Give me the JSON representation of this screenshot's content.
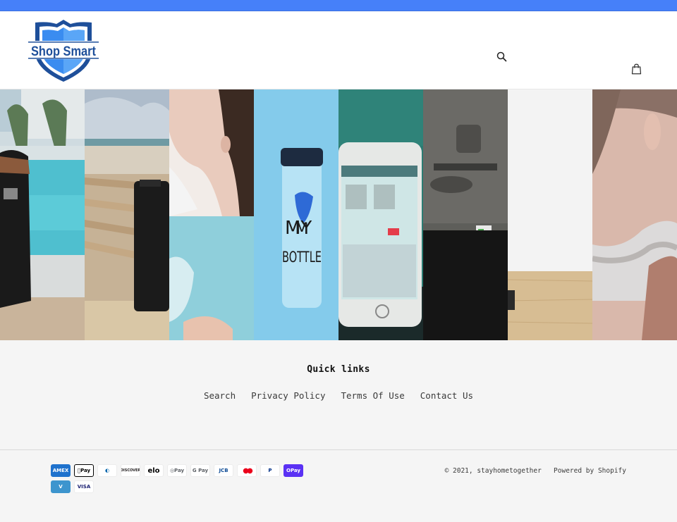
{
  "announcement": {
    "color": "#4680f9"
  },
  "header": {
    "logo": {
      "text": "Shop Smart",
      "alt": "Shop Smart logo"
    },
    "search_icon": "search-icon",
    "cart_icon": "cart-icon",
    "search_label": "Search",
    "cart_label": "Cart"
  },
  "hero": {
    "panels": [
      {
        "name": "pool-cooler-bag",
        "description": "Cooler bag beside a resort pool"
      },
      {
        "name": "beach-cooler-bag",
        "description": "Cooler bag on beach lounger"
      },
      {
        "name": "woman-drinking",
        "description": "Woman drinking from a glass"
      },
      {
        "name": "my-bottle",
        "description": "Water bottle with blue sensor",
        "text": "MY BOTTLE"
      },
      {
        "name": "phone-app",
        "description": "Phone showing sensor setup app"
      },
      {
        "name": "car-obd",
        "description": "Car interior with OBD dongle"
      },
      {
        "name": "tabletop-device",
        "description": "Small device on wooden table"
      },
      {
        "name": "neck-massager",
        "description": "Person wearing neck device"
      }
    ]
  },
  "footer": {
    "title": "Quick links",
    "links": [
      {
        "label": "Search"
      },
      {
        "label": "Privacy Policy"
      },
      {
        "label": "Terms Of Use"
      },
      {
        "label": "Contact Us"
      }
    ],
    "payment_methods": [
      {
        "name": "American Express",
        "label": "AMEX",
        "bg": "#1f72cd",
        "fg": "#ffffff"
      },
      {
        "name": "Apple Pay",
        "label": "Pay",
        "bg": "#ffffff",
        "fg": "#000000"
      },
      {
        "name": "Diners Club",
        "label": "◐",
        "bg": "#ffffff",
        "fg": "#0165ac"
      },
      {
        "name": "Discover",
        "label": "DISCOVER",
        "bg": "#ffffff",
        "fg": "#231f20"
      },
      {
        "name": "Elo",
        "label": "elo",
        "bg": "#ffffff",
        "fg": "#000000"
      },
      {
        "name": "Google Pay",
        "label": "◎Pay",
        "bg": "#ffffff",
        "fg": "#5f6368"
      },
      {
        "name": "Google Pay",
        "label": "G Pay",
        "bg": "#ffffff",
        "fg": "#5f6368"
      },
      {
        "name": "JCB",
        "label": "JCB",
        "bg": "#ffffff",
        "fg": "#0e4c96"
      },
      {
        "name": "Mastercard",
        "label": "●●",
        "bg": "#ffffff",
        "fg": "#eb001b"
      },
      {
        "name": "PayPal",
        "label": "P",
        "bg": "#ffffff",
        "fg": "#003087"
      },
      {
        "name": "Shop Pay",
        "label": "OPay",
        "bg": "#5a31f4",
        "fg": "#ffffff"
      },
      {
        "name": "Venmo",
        "label": "V",
        "bg": "#3d95ce",
        "fg": "#ffffff"
      },
      {
        "name": "Visa",
        "label": "VISA",
        "bg": "#ffffff",
        "fg": "#1a1f71"
      }
    ],
    "copyright": "© 2021, stayhometogether",
    "powered_by": "Powered by Shopify"
  }
}
